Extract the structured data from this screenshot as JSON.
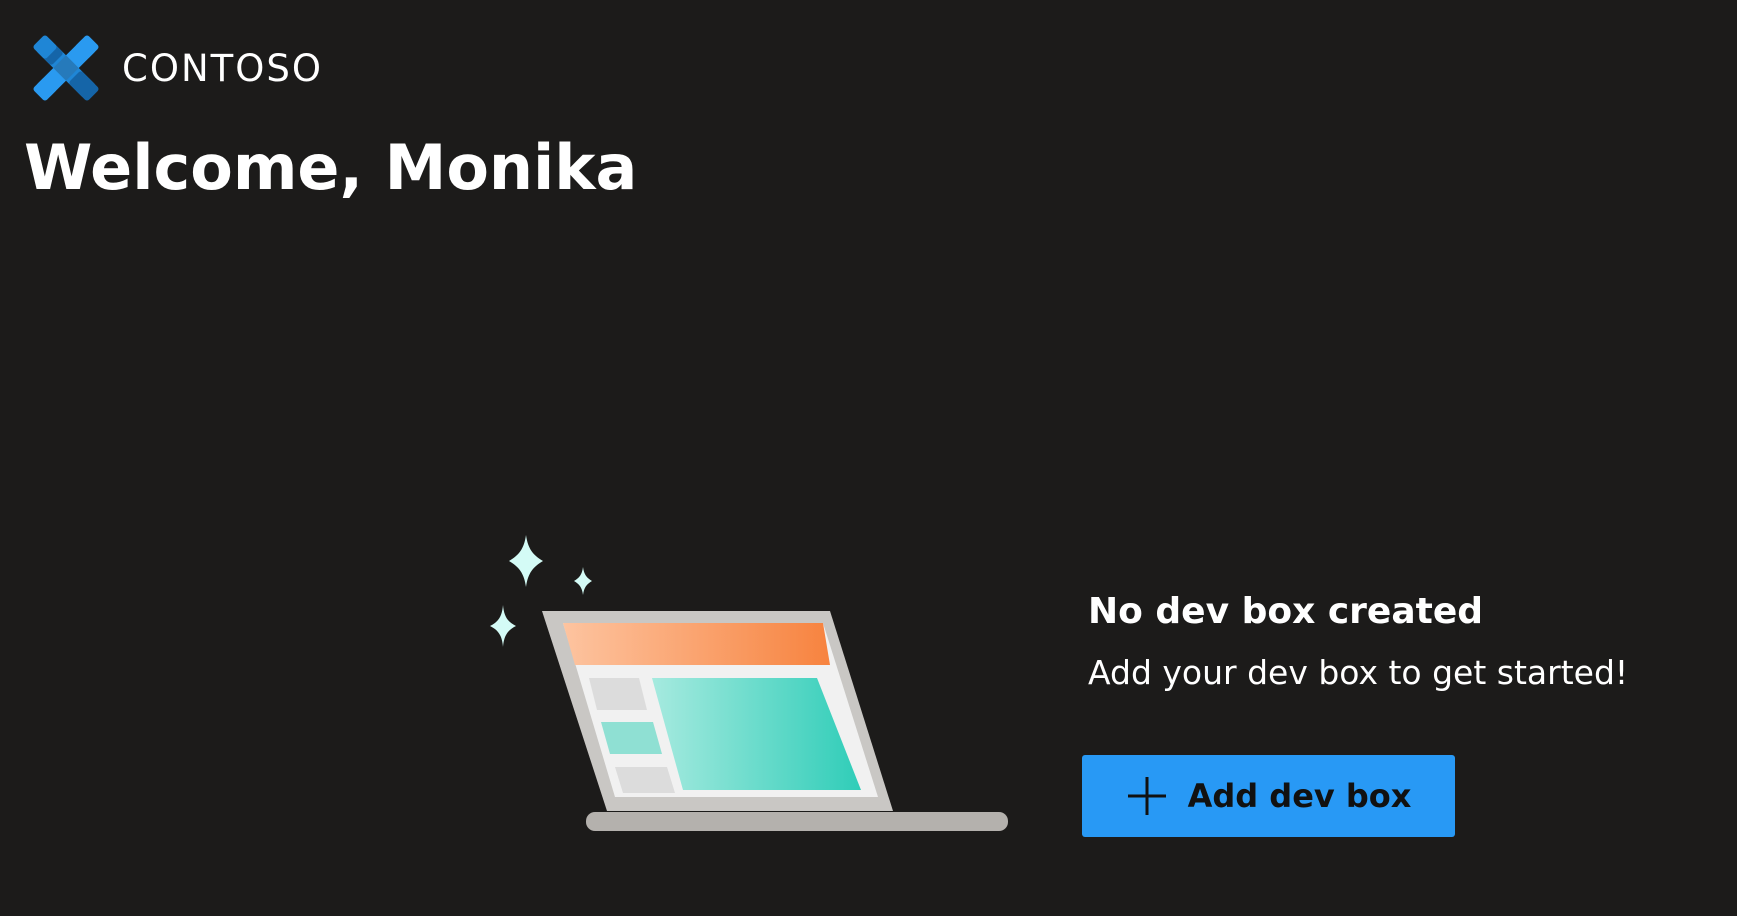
{
  "brand": {
    "name": "CONTOSO",
    "logo_icon": "contoso-logo-icon",
    "logo_color": "#1f86d6"
  },
  "header": {
    "welcome": "Welcome, Monika"
  },
  "empty_state": {
    "illustration_icon": "laptop-illustration",
    "title": "No dev box created",
    "subtitle": "Add your dev box to get started!",
    "add_button": {
      "label": "Add dev box",
      "icon": "plus-icon",
      "color": "#2899f5"
    }
  },
  "theme": {
    "background": "#1c1b1a",
    "text": "#ffffff"
  }
}
